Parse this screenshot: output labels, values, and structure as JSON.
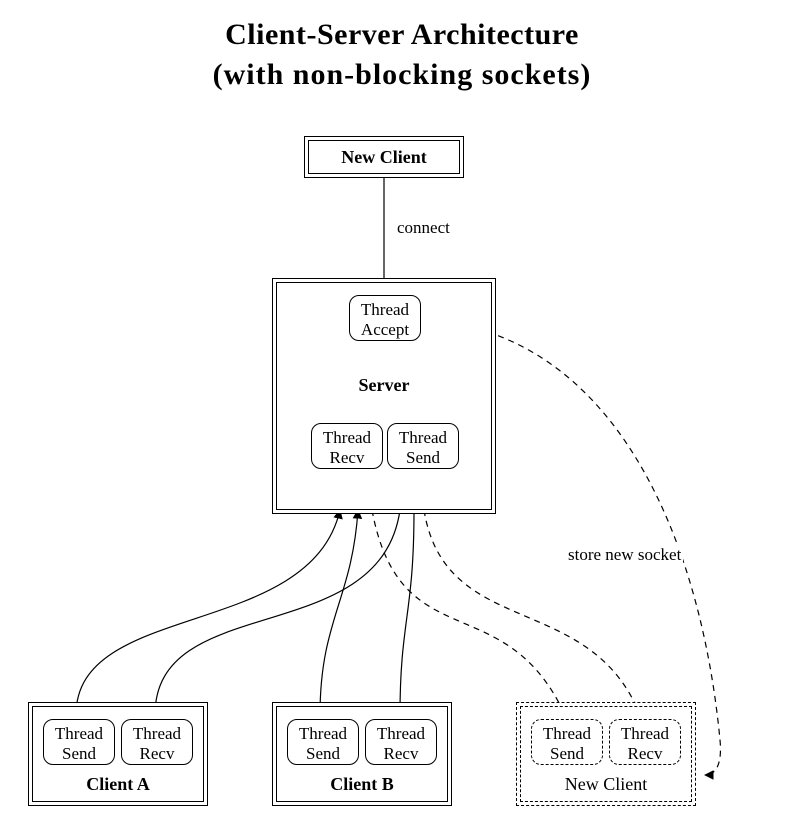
{
  "title_line1": "Client-Server Architecture",
  "title_line2": "(with non-blocking sockets)",
  "nodes": {
    "new_client_top": "New Client",
    "server": "Server",
    "thread_accept": "Thread\nAccept",
    "thread_recv": "Thread\nRecv",
    "thread_send": "Thread\nSend",
    "client_a": "Client A",
    "client_b": "Client B",
    "new_client_bottom": "New Client"
  },
  "edges": {
    "connect": "connect",
    "store_new_socket": "store new socket"
  }
}
